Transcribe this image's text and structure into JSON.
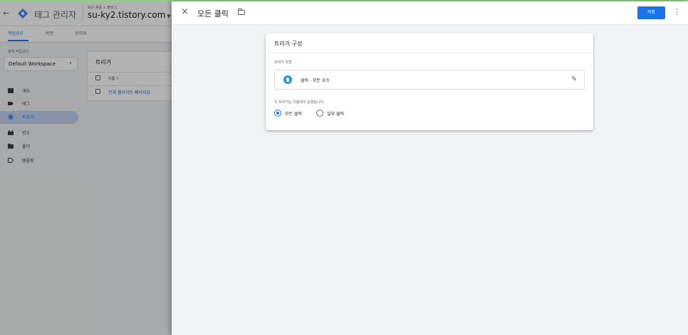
{
  "app": {
    "title": "태그 관리자",
    "breadcrumb": "모든 계정 > 블로그",
    "container": "su-ky2.tistory.com",
    "tabs": [
      {
        "label": "작업공간"
      },
      {
        "label": "버전"
      },
      {
        "label": "관리자"
      }
    ],
    "workspace_label": "현재 작업공간",
    "workspace_name": "Default Workspace",
    "nav": [
      {
        "label": "개요",
        "icon": "overview-icon"
      },
      {
        "label": "태그",
        "icon": "tag-icon"
      },
      {
        "label": "트리거",
        "icon": "trigger-icon",
        "active": true
      },
      {
        "label": "변수",
        "icon": "variables-icon"
      },
      {
        "label": "폴더",
        "icon": "folder-icon"
      },
      {
        "label": "템플릿",
        "icon": "template-icon"
      }
    ],
    "list": {
      "title": "트리거",
      "column": "이름 ↑",
      "rows": [
        "전체 웹사이트 페이지뷰"
      ]
    }
  },
  "editor": {
    "name": "모든 클릭",
    "save_label": "저장",
    "config_title": "트리거 구성",
    "type_label": "트리거 유형",
    "type_value": "클릭 - 모든 요소",
    "fire_label": "이 트리거는 다음에서 실행됩니다.",
    "options": [
      {
        "label": "모든 클릭",
        "selected": true
      },
      {
        "label": "일부 클릭",
        "selected": false
      }
    ]
  },
  "colors": {
    "accent": "#1a73e8",
    "active_nav": "#c3d3ef",
    "click_icon": "#1e9bd8"
  }
}
